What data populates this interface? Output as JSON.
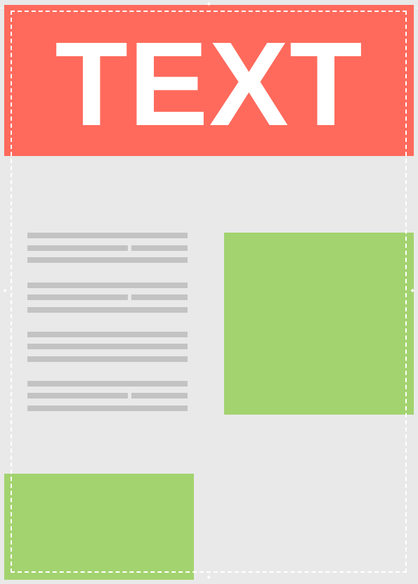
{
  "header": {
    "title": "TEXT"
  },
  "colors": {
    "background": "#e9e9e9",
    "header_block": "#ff6a5c",
    "header_text": "#ffffff",
    "text_line_placeholder": "#c3c3c3",
    "image_placeholder": "#a3d36f",
    "guide": "#ffffff"
  },
  "handles": {
    "glyph": "✦"
  }
}
